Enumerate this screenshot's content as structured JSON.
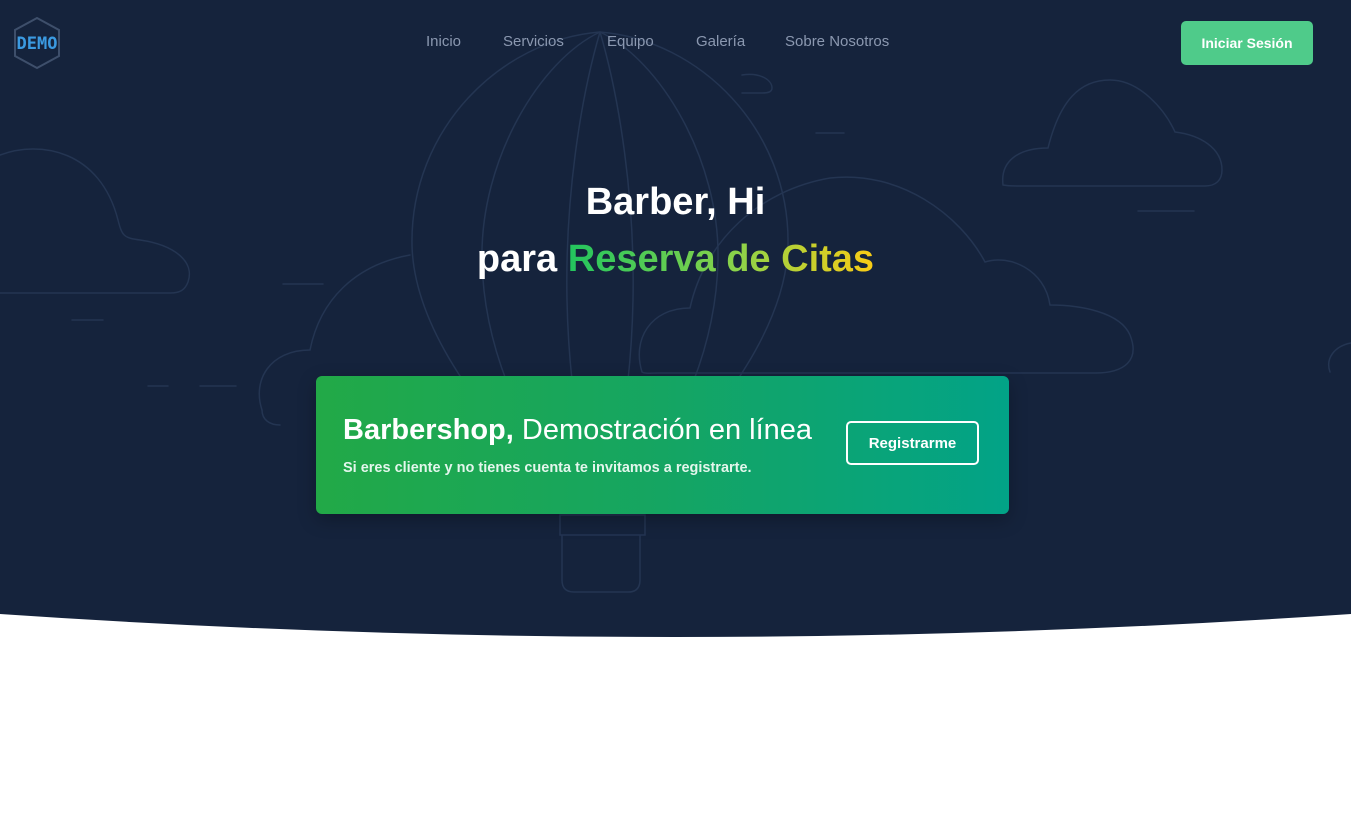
{
  "brand": {
    "logo_text": "DEMO"
  },
  "nav": {
    "items": [
      {
        "label": "Inicio"
      },
      {
        "label": "Servicios"
      },
      {
        "label": "Equipo"
      },
      {
        "label": "Galería"
      },
      {
        "label": "Sobre Nosotros"
      }
    ],
    "login_label": "Iniciar Sesión"
  },
  "hero": {
    "title_line1": "Barber, Hi",
    "title_line2_prefix": "para",
    "title_line2_highlight": "Reserva de Citas"
  },
  "cta": {
    "heading_strong": "Barbershop,",
    "heading_light": "Demostración en línea",
    "subtitle": "Si eres cliente y no tienes cuenta te invitamos a registrarte.",
    "button_label": "Registrarme"
  },
  "colors": {
    "hero_background": "#15233c",
    "accent_green": "#4fcb8a",
    "logo_blue": "#3b9ae1",
    "gradient_start": "#22c55e",
    "gradient_end": "#facc15"
  },
  "icons": {
    "logo": "hexagon-logo-icon",
    "background": "hot-air-balloon-and-clouds-illustration"
  }
}
